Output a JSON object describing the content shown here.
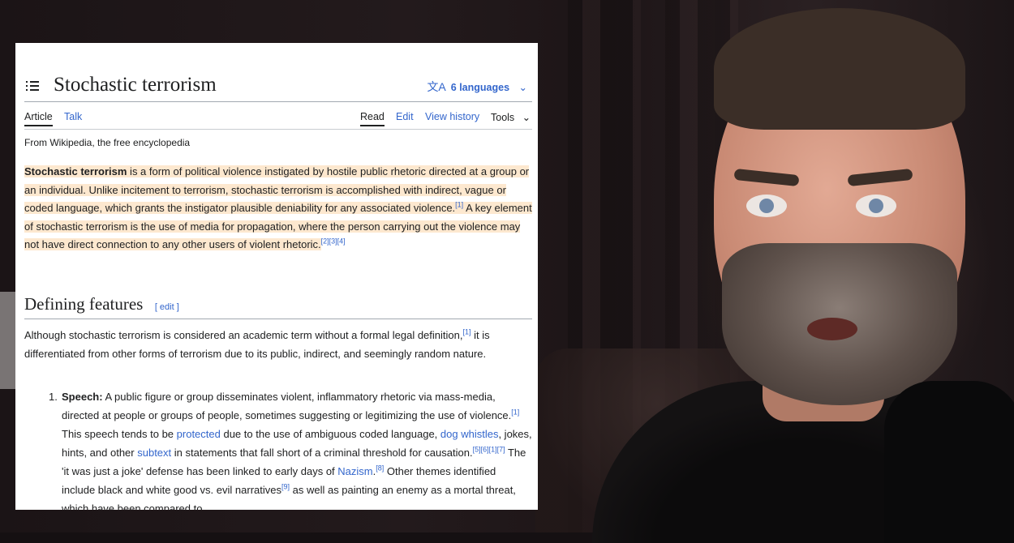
{
  "article": {
    "title": "Stochastic terrorism",
    "languages_label": "6 languages",
    "languages_icon": "translate-icon",
    "tabs_left": [
      "Article",
      "Talk"
    ],
    "tabs_right": [
      "Read",
      "Edit",
      "View history",
      "Tools"
    ],
    "tagline": "From Wikipedia, the free encyclopedia",
    "lead": {
      "term": "Stochastic terrorism",
      "text1": " is a form of political violence instigated by hostile public rhetoric directed at a group or an individual. Unlike incitement to terrorism, stochastic terrorism is accomplished with indirect, vague or coded language, which grants the instigator plausible deniability for any associated violence.",
      "ref1": "[1]",
      "text2": " A key element of stochastic terrorism is the use of media for propagation, where the person carrying out the violence may not have direct connection to any other users of violent rhetoric.",
      "ref2": "[2][3][4]"
    },
    "section": {
      "title": "Defining features",
      "edit_label": "[ edit ]"
    },
    "paragraph": {
      "text": "Although stochastic terrorism is considered an academic term without a formal legal definition,",
      "ref": "[1]",
      "text2": " it is differentiated from other forms of terrorism due to its public, indirect, and seemingly random nature."
    },
    "list_item_1": {
      "number": "1.",
      "term": "Speech:",
      "t1": " A public figure or group disseminates violent, inflammatory rhetoric via mass-media, directed at people or groups of people, sometimes suggesting or legitimizing the use of violence.",
      "r1": "[1]",
      "t2": " This speech tends to be ",
      "link1": "protected",
      "t3": " due to the use of ambiguous coded language, ",
      "link2": "dog whistles",
      "t4": ", jokes, hints, and other ",
      "link3": "subtext",
      "t5": " in statements that fall short of a criminal threshold for causation.",
      "r2": "[5][6][1][7]",
      "t6": " The 'it was just a joke' defense has been linked to early days of ",
      "link4": "Nazism",
      "t7": ".",
      "r3": "[8]",
      "t8": " Other themes identified include black and white good vs. evil narratives",
      "r4": "[9]",
      "t9": " as well as painting an enemy as a mortal threat, which have been compared to"
    }
  },
  "colors": {
    "link": "#3366cc",
    "highlight": "#fde8cf",
    "text": "#202122"
  }
}
